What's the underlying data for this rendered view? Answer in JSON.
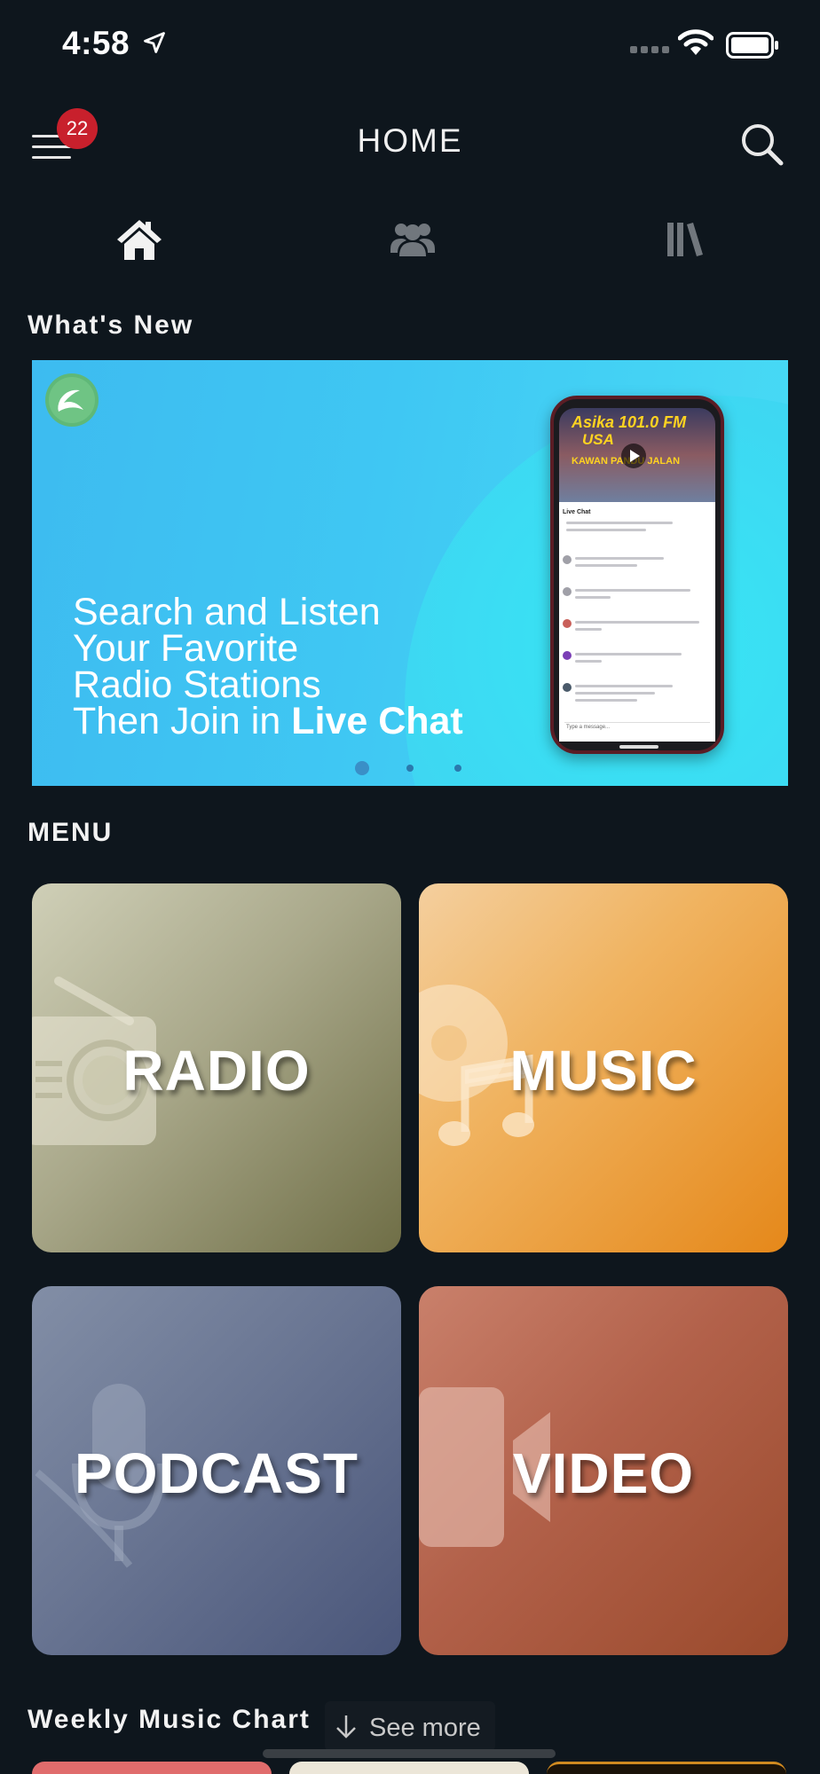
{
  "status_bar": {
    "time": "4:58",
    "icons": [
      "location-arrow-icon",
      "cellular-signal-icon",
      "wifi-icon",
      "battery-icon"
    ]
  },
  "header": {
    "title": "HOME",
    "menu_icon": "hamburger-menu-icon",
    "notification_count": "22",
    "search_icon": "search-icon"
  },
  "tabs": [
    {
      "icon": "home-icon",
      "active": true
    },
    {
      "icon": "users-icon",
      "active": false
    },
    {
      "icon": "library-icon",
      "active": false
    }
  ],
  "whats_new": {
    "title": "What's New",
    "banner": {
      "headline_lines": [
        "Search and Listen",
        "Your Favorite",
        "Radio Stations",
        "Then Join in "
      ],
      "headline_bold": "Live Chat",
      "phone_text": {
        "station": "Asika 101.0 FM",
        "station2": "USA",
        "tagline": "KAWAN PANDU JALAN",
        "chat_title": "Live Chat",
        "input_placeholder": "Type a message..."
      },
      "slides": 3,
      "active_slide": 1
    }
  },
  "menu": {
    "title": "MENU",
    "tiles": [
      {
        "label": "RADIO",
        "icon": "radio-icon"
      },
      {
        "label": "MUSIC",
        "icon": "music-icon"
      },
      {
        "label": "PODCAST",
        "icon": "microphone-icon"
      },
      {
        "label": "VIDEO",
        "icon": "video-camera-icon"
      }
    ]
  },
  "weekly_chart": {
    "title": "Weekly Music Chart",
    "see_more": "See more"
  },
  "colors": {
    "background": "#0e161d",
    "badge": "#c8202c",
    "banner": "#3fc7f3"
  }
}
